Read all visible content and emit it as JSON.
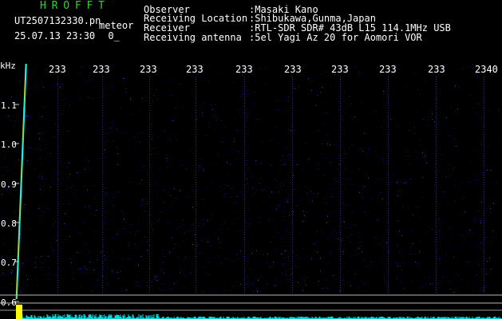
{
  "header": {
    "brand": "HROFFT",
    "filename": "UT2507132330.pn",
    "tag": "meteor",
    "timestamp": "25.07.13 23:30",
    "index": "0_",
    "info": [
      {
        "label": "Observer",
        "value": ":Masaki Kano"
      },
      {
        "label": "Receiving Location",
        "value": ":Shibukawa,Gunma,Japan"
      },
      {
        "label": "Receiver",
        "value": ":RTL-SDR SDR# 43dB L15 114.1MHz USB"
      },
      {
        "label": "Receiving antenna",
        "value": ":5el Yagi Az 20 for Aomori VOR"
      }
    ]
  },
  "spectrogram": {
    "frequency_unit": "kHz",
    "frequency_ticks": [
      "1.1",
      "1.0",
      "0.9",
      "0.8",
      "0.7",
      "0.6"
    ],
    "time_ticks": [
      "233",
      "233",
      "233",
      "233",
      "233",
      "233",
      "233",
      "233",
      "233",
      "2340"
    ],
    "colors": {
      "background": "#000000",
      "noise": "#1a1a8c",
      "signal": "#00ffff",
      "marker": "#ffff00",
      "baseline": "#c8c8c8",
      "brand": "#2bd62b"
    }
  }
}
